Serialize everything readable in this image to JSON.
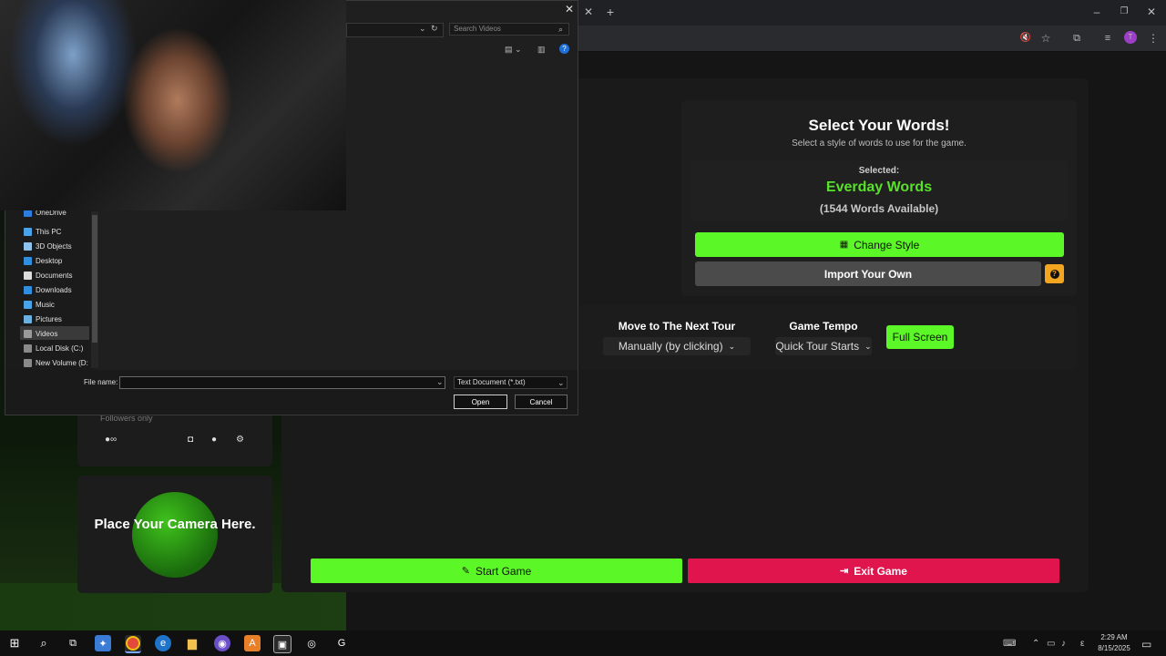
{
  "dialog": {
    "search_placeholder": "Search Videos",
    "nav_items": [
      "OneDrive",
      "This PC",
      "3D Objects",
      "Desktop",
      "Documents",
      "Downloads",
      "Music",
      "Pictures",
      "Videos",
      "Local Disk (C:)",
      "New Volume (D:"
    ],
    "filename_label": "File name:",
    "filetype": "Text Document (*.txt)",
    "open_label": "Open",
    "cancel_label": "Cancel",
    "close_glyph": "✕"
  },
  "game": {
    "title": "Select Your Words!",
    "subtitle": "Select a style of words to use for the game.",
    "selected_label": "Selected:",
    "selected_style": "Everday Words",
    "word_count": "(1544 Words Available)",
    "change_style_label": "Change Style",
    "import_own_label": "Import Your Own",
    "help_glyph": "?",
    "next_tour_label": "Move to The Next Tour",
    "next_tour_value": "Manually (by clicking)",
    "tempo_label": "Game Tempo",
    "tempo_value": "Quick Tour Starts",
    "full_screen_label": "Full Screen",
    "start_label": "Start Game",
    "exit_label": "Exit Game"
  },
  "widgets": {
    "followers_text": "Followers only",
    "camera_text": "Place Your Camera Here."
  },
  "taskbar": {
    "time": "2:29 AM",
    "date": "8/15/2025"
  },
  "colors": {
    "accent_green": "#5cf726",
    "selected_green": "#58e12a",
    "exit_red": "#e0154e",
    "help_orange": "#f2a51e"
  }
}
